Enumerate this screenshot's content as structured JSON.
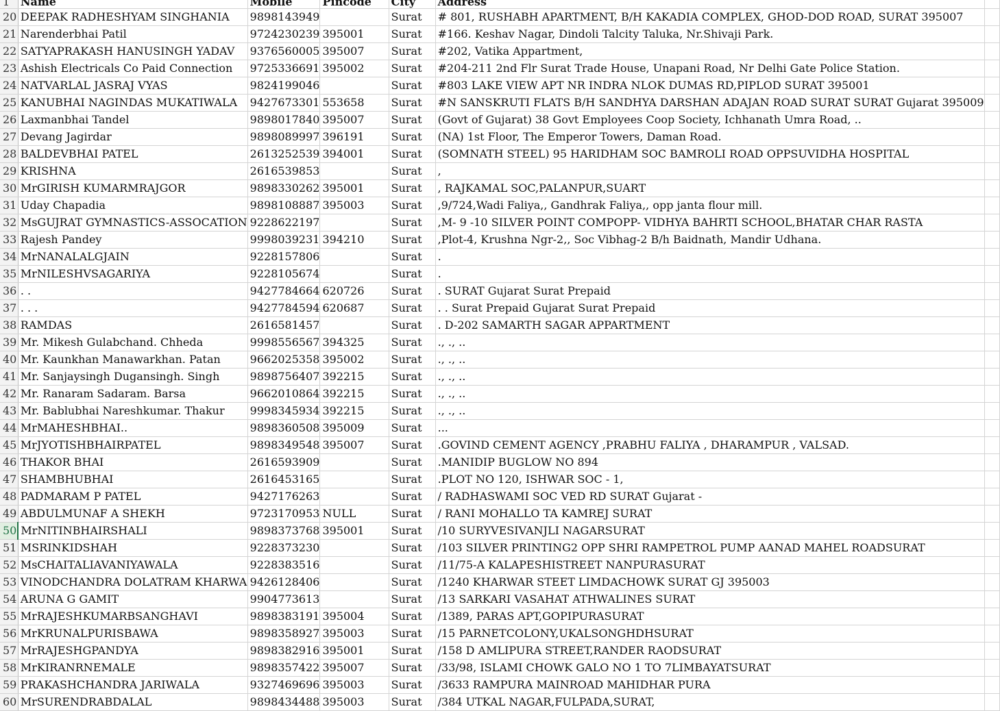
{
  "sheet": {
    "header_row_number": "1",
    "columns": [
      "Name",
      "Mobile",
      "Pincode",
      "City",
      "Address",
      ""
    ],
    "selected_row": "50",
    "rows": [
      [
        "20",
        "DEEPAK RADHESHYAM SINGHANIA",
        "9898143949",
        "",
        "Surat",
        "# 801, RUSHABH APARTMENT,  B/H KAKADIA COMPLEX, GHOD-DOD ROAD,  SURAT    395007"
      ],
      [
        "21",
        "Narenderbhai Patil",
        "9724230239",
        "395001",
        "Surat",
        "#166. Keshav Nagar, Dindoli Talcity Taluka, Nr.Shivaji Park."
      ],
      [
        "22",
        "SATYAPRAKASH HANUSINGH YADAV",
        "9376560005",
        "395007",
        "Surat",
        "#202, Vatika Appartment,"
      ],
      [
        "23",
        "Ashish Electricals Co Paid Connection",
        "9725336691",
        "395002",
        "Surat",
        "#204-211 2nd Flr Surat Trade House, Unapani Road, Nr Delhi Gate Police Station."
      ],
      [
        "24",
        "NATVARLAL JASRAJ VYAS",
        "9824199046",
        "",
        "Surat",
        "#803 LAKE VIEW APT   NR INDRA NLOK   DUMAS RD,PIPLOD SURAT    395001"
      ],
      [
        "25",
        "KANUBHAI  NAGINDAS  MUKATIWALA",
        "9427673301",
        "553658",
        "Surat",
        "#N SANSKRUTI FLATS B/H SANDHYA DARSHAN ADAJAN ROAD SURAT SURAT Gujarat 395009"
      ],
      [
        "26",
        "Laxmanbhai Tandel",
        "9898017840",
        "395007",
        "Surat",
        "(Govt of Gujarat) 38 Govt Employees Coop Society, Ichhanath Umra Road, .."
      ],
      [
        "27",
        "Devang Jagirdar",
        "9898089997",
        "396191",
        "Surat",
        "(NA) 1st Floor, The Emperor Towers, Daman Road."
      ],
      [
        "28",
        "BALDEVBHAI PATEL",
        "2613252539",
        "394001",
        "Surat",
        "(SOMNATH STEEL) 95 HARIDHAM SOC BAMROLI ROAD OPPSUVIDHA HOSPITAL"
      ],
      [
        "29",
        "KRISHNA",
        "2616539853",
        "",
        "Surat",
        ","
      ],
      [
        "30",
        "MrGIRISH KUMARMRAJGOR",
        "9898330262",
        "395001",
        "Surat",
        ", RAJKAMAL SOC,PALANPUR,SUART"
      ],
      [
        "31",
        "Uday Chapadia",
        "9898108887",
        "395003",
        "Surat",
        ",9/724,Wadi Faliya,, Gandhrak Faliya,, opp janta flour mill."
      ],
      [
        "32",
        "MsGUJRAT GYMNASTICS-ASSOCATION",
        "9228622197",
        "",
        "Surat",
        ",M- 9 -10 SILVER POINT COMPOPP- VIDHYA BAHRTI SCHOOL,BHATAR CHAR RASTA"
      ],
      [
        "33",
        "Rajesh Pandey",
        "9998039231",
        "394210",
        "Surat",
        ",Plot-4, Krushna Ngr-2,, Soc Vibhag-2 B/h Baidnath, Mandir Udhana."
      ],
      [
        "34",
        "MrNANALALGJAIN",
        "9228157806",
        "",
        "Surat",
        "."
      ],
      [
        "35",
        "MrNILESHVSAGARIYA",
        "9228105674",
        "",
        "Surat",
        "."
      ],
      [
        "36",
        ".    .",
        "9427784664",
        "620726",
        "Surat",
        ".   SURAT Gujarat Surat  Prepaid"
      ],
      [
        "37",
        ".  .  .",
        "9427784594",
        "620687",
        "Surat",
        ". .  Surat  Prepaid Gujarat Surat  Prepaid"
      ],
      [
        "38",
        "RAMDAS",
        "2616581457",
        "",
        "Surat",
        ". D-202 SAMARTH SAGAR APPARTMENT"
      ],
      [
        "39",
        "Mr. Mikesh Gulabchand. Chheda",
        "9998556567",
        "394325",
        "Surat",
        "., ., .."
      ],
      [
        "40",
        "Mr. Kaunkhan Manawarkhan. Patan",
        "9662025358",
        "395002",
        "Surat",
        "., ., .."
      ],
      [
        "41",
        "Mr. Sanjaysingh Dugansingh. Singh",
        "9898756407",
        "392215",
        "Surat",
        "., ., .."
      ],
      [
        "42",
        "Mr. Ranaram Sadaram. Barsa",
        "9662010864",
        "392215",
        "Surat",
        "., ., .."
      ],
      [
        "43",
        "Mr. Bablubhai Nareshkumar. Thakur",
        "9998345934",
        "392215",
        "Surat",
        "., ., .."
      ],
      [
        "44",
        "MrMAHESHBHAI..",
        "9898360508",
        "395009",
        "Surat",
        "..."
      ],
      [
        "45",
        "MrJYOTISHBHAIRPATEL",
        "9898349548",
        "395007",
        "Surat",
        ".GOVIND CEMENT AGENCY ,PRABHU FALIYA , DHARAMPUR , VALSAD."
      ],
      [
        "46",
        "THAKOR BHAI",
        "2616593909",
        "",
        "Surat",
        ".MANIDIP BUGLOW NO 894"
      ],
      [
        "47",
        "SHAMBHUBHAI",
        "2616453165",
        "",
        "Surat",
        ".PLOT NO 120, ISHWAR SOC - 1,"
      ],
      [
        "48",
        "PADMARAM  P  PATEL",
        "9427176263",
        "",
        "Surat",
        "/ RADHASWAMI SOC VED RD  SURAT Gujarat -"
      ],
      [
        "49",
        "ABDULMUNAF A SHEKH",
        "9723170953",
        "NULL",
        "Surat",
        "/ RANI  MOHALLO TA KAMREJ SURAT"
      ],
      [
        "50",
        "MrNITINBHAIRSHALI",
        "9898373768",
        "395001",
        "Surat",
        "/10 SURYVESIVANJLI NAGARSURAT"
      ],
      [
        "51",
        "MSRINKIDSHAH",
        "9228373230",
        "",
        "Surat",
        "/103 SILVER PRINTING2 OPP SHRI RAMPETROL PUMP AANAD MAHEL ROADSURAT"
      ],
      [
        "52",
        "MsCHAITALIAVANIYAWALA",
        "9228383516",
        "",
        "Surat",
        "/11/75-A KALAPESHISTREET NANPURASURAT"
      ],
      [
        "53",
        "VINODCHANDRA  DOLATRAM  KHARWA",
        "9426128406",
        "",
        "Surat",
        "/1240  KHARWAR STEET LIMDACHOWK  SURAT GJ 395003"
      ],
      [
        "54",
        "ARUNA G GAMIT",
        "9904773613",
        "",
        "Surat",
        "/13 SARKARI VASAHAT ATHWALINES SURAT"
      ],
      [
        "55",
        "MrRAJESHKUMARBSANGHAVI",
        "9898383191",
        "395004",
        "Surat",
        "/1389, PARAS APT,GOPIPURASURAT"
      ],
      [
        "56",
        "MrKRUNALPURISBAWA",
        "9898358927",
        "395003",
        "Surat",
        "/15 PARNETCOLONY,UKALSONGHDHSURAT"
      ],
      [
        "57",
        "MrRAJESHGPANDYA",
        "9898382916",
        "395001",
        "Surat",
        "/158 D AMLIPURA STREET,RANDER RAODSURAT"
      ],
      [
        "58",
        "MrKIRANRNEMALE",
        "9898357422",
        "395007",
        "Surat",
        "/33/98, ISLAMI CHOWK GALO NO 1 TO 7LIMBAYATSURAT"
      ],
      [
        "59",
        "PRAKASHCHANDRA JARIWALA",
        "9327469696",
        "395003",
        "Surat",
        "/3633 RAMPURA MAINROAD MAHIDHAR PURA"
      ],
      [
        "60",
        "MrSURENDRABDALAL",
        "9898434488",
        "395003",
        "Surat",
        "/384 UTKAL NAGAR,FULPADA,SURAT,"
      ]
    ]
  }
}
